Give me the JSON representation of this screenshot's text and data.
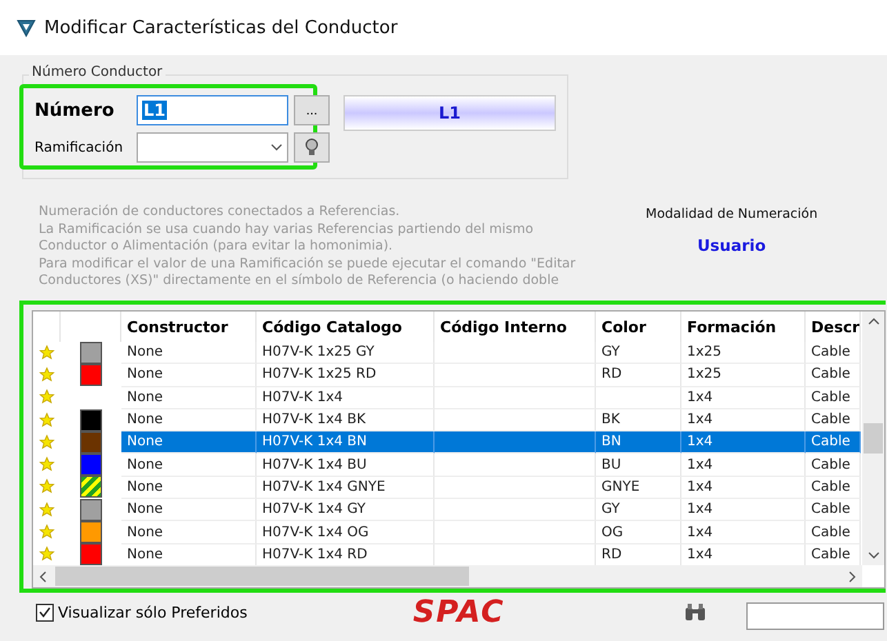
{
  "window": {
    "title": "Modificar Características del Conductor"
  },
  "numero_group": {
    "title": "Número Conductor",
    "numero_label": "Número",
    "numero_value": "L1",
    "browse_button": "...",
    "ramificacion_label": "Ramificación",
    "preview": "L1"
  },
  "help_text": [
    "Numeración de conductores conectados a Referencias.",
    "La Ramificación se usa cuando hay varias Referencias partiendo del mismo",
    "Conductor o Alimentación (para evitar la homonimia).",
    "Para modificar el valor de una Ramificación se puede ejecutar el comando \"Editar",
    "Conductores (XS)\" directamente en el símbolo de Referencia (o haciendo doble"
  ],
  "numbering_mode": {
    "label": "Modalidad de Numeración",
    "value": "Usuario"
  },
  "table": {
    "columns": [
      "Constructor",
      "Código Catalogo",
      "Código Interno",
      "Color",
      "Formación",
      "Descr"
    ],
    "rows": [
      {
        "preferred": true,
        "striped": false,
        "color": "#a0a0a0",
        "selected": false,
        "cells": [
          "None",
          "H07V-K  1x25 GY",
          "",
          "GY",
          "1x25",
          "Cable"
        ]
      },
      {
        "preferred": true,
        "striped": false,
        "color": "#ff0000",
        "selected": false,
        "cells": [
          "None",
          "H07V-K  1x25 RD",
          "",
          "RD",
          "1x25",
          "Cable"
        ]
      },
      {
        "preferred": true,
        "selected": false,
        "cells": [
          "None",
          "H07V-K  1x4",
          "",
          "",
          "1x4",
          "Cable"
        ]
      },
      {
        "preferred": true,
        "striped": false,
        "color": "#000000",
        "selected": false,
        "cells": [
          "None",
          "H07V-K  1x4 BK",
          "",
          "BK",
          "1x4",
          "Cable"
        ]
      },
      {
        "preferred": true,
        "striped": false,
        "color": "#6b3300",
        "selected": true,
        "cells": [
          "None",
          "H07V-K  1x4 BN",
          "",
          "BN",
          "1x4",
          "Cable"
        ]
      },
      {
        "preferred": true,
        "striped": false,
        "color": "#0000ff",
        "selected": false,
        "cells": [
          "None",
          "H07V-K  1x4 BU",
          "",
          "BU",
          "1x4",
          "Cable"
        ]
      },
      {
        "preferred": true,
        "striped": true,
        "color": "#22a022",
        "selected": false,
        "cells": [
          "None",
          "H07V-K  1x4 GNYE",
          "",
          "GNYE",
          "1x4",
          "Cable"
        ]
      },
      {
        "preferred": true,
        "striped": false,
        "color": "#a0a0a0",
        "selected": false,
        "cells": [
          "None",
          "H07V-K  1x4 GY",
          "",
          "GY",
          "1x4",
          "Cable"
        ]
      },
      {
        "preferred": true,
        "striped": false,
        "color": "#ff9900",
        "selected": false,
        "cells": [
          "None",
          "H07V-K  1x4 OG",
          "",
          "OG",
          "1x4",
          "Cable"
        ]
      },
      {
        "preferred": true,
        "striped": false,
        "color": "#ff0000",
        "selected": false,
        "cells": [
          "None",
          "H07V-K  1x4 RD",
          "",
          "RD",
          "1x4",
          "Cable"
        ]
      }
    ]
  },
  "only_preferred": {
    "label": "Visualizar sólo Preferidos",
    "checked": true
  },
  "logo": "SPAC"
}
